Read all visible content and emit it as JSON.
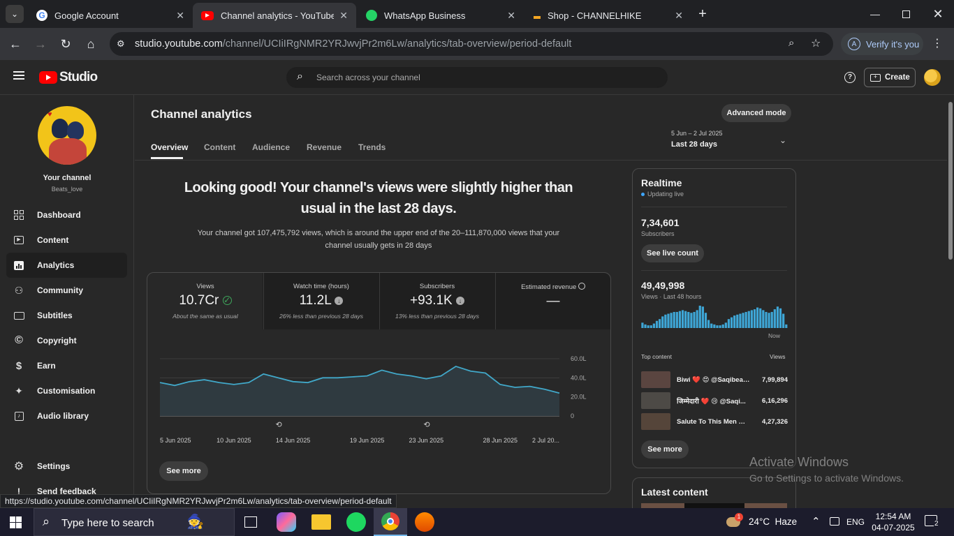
{
  "browser": {
    "tabs": [
      {
        "title": "Google Account",
        "favicon_color": "#4285f4"
      },
      {
        "title": "Channel analytics - YouTube Studio",
        "favicon_color": "#ff0000"
      },
      {
        "title": "WhatsApp Business",
        "favicon_color": "#25d366"
      },
      {
        "title": "Shop - CHANNELHIKE",
        "favicon_color": "#f5a623"
      }
    ],
    "url_host": "studio.youtube.com",
    "url_path": "/channel/UCIiIRgNMR2YRJwvjPr2m6Lw/analytics/tab-overview/period-default",
    "verify_label": "Verify it's you",
    "verify_avatar": "A",
    "status_url": "https://studio.youtube.com/channel/UCIiIRgNMR2YRJwvjPr2m6Lw/analytics/tab-overview/period-default"
  },
  "header": {
    "logo_text": "Studio",
    "search_placeholder": "Search across your channel",
    "create_label": "Create"
  },
  "sidebar": {
    "channel_label": "Your channel",
    "channel_handle": "Beats_love",
    "items": [
      {
        "label": "Dashboard",
        "icon": "dashboard-icon"
      },
      {
        "label": "Content",
        "icon": "content-icon"
      },
      {
        "label": "Analytics",
        "icon": "analytics-icon"
      },
      {
        "label": "Community",
        "icon": "community-icon"
      },
      {
        "label": "Subtitles",
        "icon": "subtitles-icon"
      },
      {
        "label": "Copyright",
        "icon": "copyright-icon"
      },
      {
        "label": "Earn",
        "icon": "earn-icon"
      },
      {
        "label": "Customisation",
        "icon": "customisation-icon"
      },
      {
        "label": "Audio library",
        "icon": "audio-library-icon"
      }
    ],
    "settings_label": "Settings",
    "feedback_label": "Send feedback"
  },
  "analytics": {
    "page_title": "Channel analytics",
    "advanced_label": "Advanced mode",
    "tabs": [
      "Overview",
      "Content",
      "Audience",
      "Revenue",
      "Trends"
    ],
    "date_range": "5 Jun – 2 Jul 2025",
    "period_label": "Last 28 days",
    "headline": "Looking good! Your channel's views were slightly higher than usual in the last 28 days.",
    "summary": "Your channel got 107,475,792 views, which is around the upper end of the 20–111,870,000 views that your channel usually gets in 28 days",
    "metrics": [
      {
        "label": "Views",
        "value": "10.7Cr",
        "note": "About the same as usual"
      },
      {
        "label": "Watch time (hours)",
        "value": "11.2L",
        "note": "26% less than previous 28 days"
      },
      {
        "label": "Subscribers",
        "value": "+93.1K",
        "note": "13% less than previous 28 days"
      },
      {
        "label": "Estimated revenue",
        "value": "—",
        "note": ""
      }
    ],
    "see_more": "See more"
  },
  "chart_data": {
    "type": "area",
    "y_ticks": [
      "60.0L",
      "40.0L",
      "20.0L",
      "0"
    ],
    "ylim": [
      0,
      60
    ],
    "x_ticks": [
      "5 Jun 2025",
      "10 Jun 2025",
      "14 Jun 2025",
      "19 Jun 2025",
      "23 Jun 2025",
      "28 Jun 2025",
      "2 Jul 20..."
    ],
    "values": [
      35,
      32,
      36,
      38,
      35,
      33,
      35,
      44,
      40,
      36,
      35,
      40,
      40,
      41,
      42,
      48,
      44,
      42,
      39,
      42,
      52,
      47,
      45,
      33,
      30,
      31,
      28,
      24
    ]
  },
  "realtime": {
    "title": "Realtime",
    "updating": "Updating live",
    "subscribers": "7,34,601",
    "subscribers_label": "Subscribers",
    "live_count_label": "See live count",
    "views": "49,49,998",
    "views_label": "Views · Last 48 hours",
    "now_label": "Now",
    "bars": [
      6,
      4,
      3,
      3,
      5,
      8,
      10,
      13,
      15,
      16,
      17,
      18,
      18,
      19,
      20,
      19,
      18,
      17,
      18,
      20,
      25,
      24,
      17,
      9,
      5,
      4,
      3,
      3,
      4,
      6,
      10,
      12,
      14,
      15,
      16,
      17,
      18,
      19,
      20,
      21,
      23,
      22,
      20,
      18,
      17,
      18,
      21,
      24,
      22,
      16,
      4
    ],
    "top_content_label": "Top content",
    "views_col": "Views",
    "top_content": [
      {
        "title": "Biwi ❤️ 😍 @Saqibeaifi...",
        "views": "7,99,894"
      },
      {
        "title": "जिम्मेदारी ❤️ 😢 @Saqi...",
        "views": "6,16,296"
      },
      {
        "title": "Salute To This Men ❤️ ...",
        "views": "4,27,326"
      }
    ],
    "see_more": "See more",
    "latest_label": "Latest content"
  },
  "watermark": {
    "line1": "Activate Windows",
    "line2": "Go to Settings to activate Windows."
  },
  "taskbar": {
    "search_placeholder": "Type here to search",
    "weather": "24°C  Haze",
    "weather_badge": "1",
    "lang": "ENG",
    "time": "12:54 AM",
    "date": "04-07-2025",
    "notif": "2"
  }
}
